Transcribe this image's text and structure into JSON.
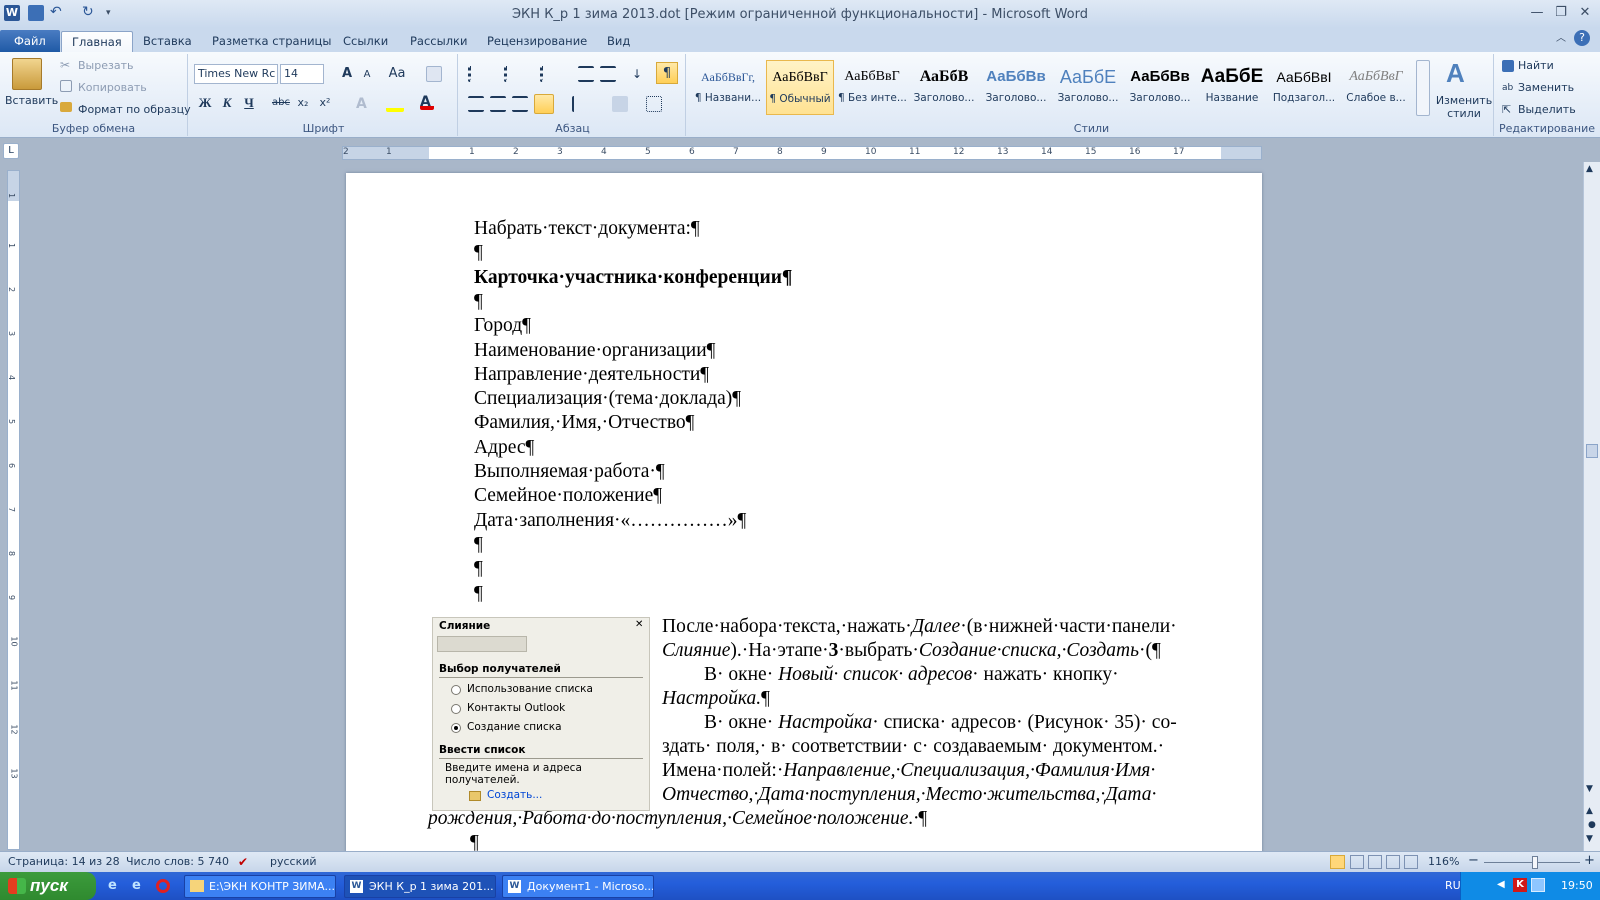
{
  "window": {
    "title": "ЭКН К_р 1 зима 2013.dot [Режим ограниченной функциональности]  -  Microsoft Word",
    "controls": {
      "minimize": "—",
      "restore": "❐",
      "close": "✕"
    }
  },
  "tabs": [
    "Файл",
    "Главная",
    "Вставка",
    "Разметка страницы",
    "Ссылки",
    "Рассылки",
    "Рецензирование",
    "Вид"
  ],
  "ribbon": {
    "clipboard": {
      "label": "Буфер обмена",
      "paste": "Вставить",
      "cut": "Вырезать",
      "copy": "Копировать",
      "format_painter": "Формат по образцу"
    },
    "font": {
      "label": "Шрифт",
      "font_name": "Times New Rc",
      "font_size": "14",
      "bold": "Ж",
      "italic": "К",
      "underline": "Ч",
      "strike": "abc",
      "subscript": "x₂",
      "superscript": "x²",
      "grow": "A",
      "shrink": "A",
      "case": "Aa"
    },
    "paragraph": {
      "label": "Абзац",
      "pilcrow": "¶"
    },
    "styles": {
      "label": "Стили",
      "items": [
        {
          "preview": "АаБбВвГг,",
          "name": "¶ Названи..."
        },
        {
          "preview": "АаБбВвГ",
          "name": "¶ Обычный"
        },
        {
          "preview": "АаБбВвГ",
          "name": "¶ Без инте..."
        },
        {
          "preview": "АаБбВ",
          "name": "Заголово..."
        },
        {
          "preview": "АаБбВв",
          "name": "Заголово..."
        },
        {
          "preview": "АаБбЕ",
          "name": "Заголово..."
        },
        {
          "preview": "АаБбВв",
          "name": "Заголово..."
        },
        {
          "preview": "АаБбЕ",
          "name": "Название"
        },
        {
          "preview": "АаБбВвІ",
          "name": "Подзагол..."
        },
        {
          "preview": "АаБбВвГ",
          "name": "Слабое в..."
        }
      ],
      "change": "Изменить стили"
    },
    "editing": {
      "label": "Редактирование",
      "find": "Найти",
      "replace": "Заменить",
      "select": "Выделить"
    }
  },
  "ruler": {
    "ticks": [
      "2",
      "1",
      "1",
      "2",
      "3",
      "4",
      "5",
      "6",
      "7",
      "8",
      "9",
      "10",
      "11",
      "12",
      "13",
      "14",
      "15",
      "16",
      "17"
    ],
    "vticks": [
      "1",
      "1",
      "2",
      "3",
      "4",
      "5",
      "6",
      "7",
      "8",
      "9",
      "10",
      "11",
      "12",
      "13"
    ]
  },
  "document": {
    "lines": [
      {
        "text": "Набрать·текст·документа:¶",
        "bold": false
      },
      {
        "text": "¶",
        "bold": false
      },
      {
        "text": "Карточка·участника·конференции¶",
        "bold": true
      },
      {
        "text": "¶",
        "bold": false
      },
      {
        "text": "Город¶",
        "bold": false
      },
      {
        "text": "Наименование·организации¶",
        "bold": false
      },
      {
        "text": "Направление·деятельности¶",
        "bold": false
      },
      {
        "text": "Специализация·(тема·доклада)¶",
        "bold": false
      },
      {
        "text": "Фамилия,·Имя,·Отчество¶",
        "bold": false
      },
      {
        "text": "Адрес¶",
        "bold": false
      },
      {
        "text": "Выполняемая·работа·¶",
        "bold": false
      },
      {
        "text": "Семейное·положение¶",
        "bold": false
      },
      {
        "text": "Дата·заполнения·«……………»¶",
        "bold": false
      },
      {
        "text": "¶",
        "bold": false
      },
      {
        "text": "¶",
        "bold": false
      },
      {
        "text": "¶",
        "bold": false
      }
    ],
    "p1_a": "После·набора·текста,·нажать·",
    "p1_b": "Далее",
    "p1_c": "·(в·нижней·части·панели·",
    "p1_d": "Слияние",
    "p1_e": ").·На·этапе·",
    "p1_f": "3",
    "p1_g": "·выбрать·",
    "p1_h": "Создание·списка,·Создать",
    "p1_i": "·(¶",
    "p2_a": "В·  окне·  ",
    "p2_b": "Новый·  список·  адресов",
    "p2_c": "·  нажать·  кнопку·",
    "p2_d": "Настройка.",
    "p2_e": "¶",
    "p3_a": "В·  окне·  ",
    "p3_b": "Настройка",
    "p3_c": "·  списка·  адресов·  (Рисунок·  35)·  со-",
    "p3_line2": "здать·  поля,·  в·  соответствии·  с·  создаваемым·  документом.·",
    "p3_line3_a": "Имена·полей:·",
    "p3_line3_b": "Направление,·Специализация,·Фамилия·Имя·",
    "p3_line4": "Отчество,·Дата·поступления,·Место·жительства,·Дата·",
    "p3_line5": "рождения,·Работа·до·поступления,·Семейное·положение.·",
    "p3_end": "¶",
    "last": "¶"
  },
  "merge_panel": {
    "title": "Слияние",
    "close": "✕",
    "section1": "Выбор получателей",
    "options": [
      "Использование списка",
      "Контакты Outlook",
      "Создание списка"
    ],
    "selected": 2,
    "section2": "Ввести список",
    "hint": "Введите имена и адреса получателей.",
    "create_link": "Создать..."
  },
  "status": {
    "page": "Страница: 14 из 28",
    "words": "Число слов: 5 740",
    "lang": "русский",
    "zoom": "116%",
    "zoom_minus": "−",
    "zoom_plus": "+"
  },
  "taskbar": {
    "start": "пуск",
    "items": [
      "E:\\ЭКН КОНТР ЗИМА...",
      "ЭКН К_р 1 зима 201...",
      "Документ1 - Microso..."
    ],
    "lang": "RU",
    "time": "19:50"
  },
  "colors": {
    "accent": "#2b5797",
    "taskbar": "#245edb",
    "ribbon": "#dce7f5"
  }
}
